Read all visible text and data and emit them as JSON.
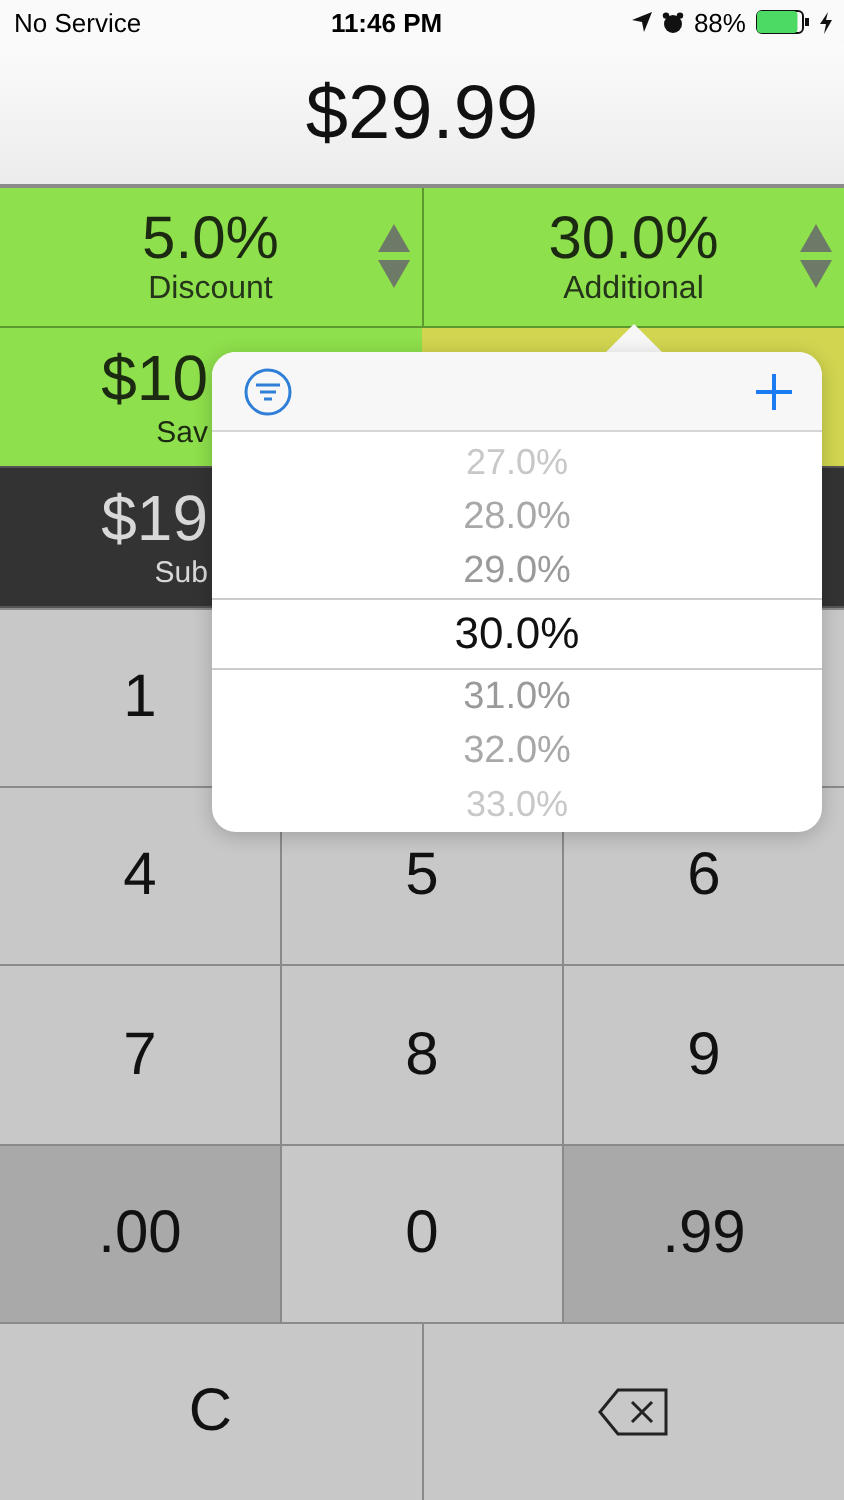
{
  "status_bar": {
    "carrier": "No Service",
    "time": "11:46 PM",
    "battery_percent": "88%",
    "battery": {
      "level": 0.88,
      "charging": true
    }
  },
  "price": "$29.99",
  "rates": [
    {
      "value": "5.0%",
      "label": "Discount"
    },
    {
      "value": "30.0%",
      "label": "Additional"
    }
  ],
  "results": [
    {
      "kind": "savings",
      "value": "$10",
      "label": "Sav"
    },
    {
      "kind": "subtotal",
      "value": "$19",
      "label": "Sub"
    }
  ],
  "keypad": [
    [
      {
        "label": "1",
        "kind": "digit"
      }
    ],
    [
      {
        "label": "4",
        "kind": "digit"
      },
      {
        "label": "5",
        "kind": "digit"
      },
      {
        "label": "6",
        "kind": "digit"
      }
    ],
    [
      {
        "label": "7",
        "kind": "digit"
      },
      {
        "label": "8",
        "kind": "digit"
      },
      {
        "label": "9",
        "kind": "digit"
      }
    ],
    [
      {
        "label": ".00",
        "kind": "special"
      },
      {
        "label": "0",
        "kind": "digit"
      },
      {
        "label": ".99",
        "kind": "special"
      }
    ],
    [
      {
        "label": "C",
        "kind": "clear"
      },
      {
        "kind": "backspace"
      }
    ]
  ],
  "picker": {
    "options": [
      {
        "label": "27.0%",
        "selected": false
      },
      {
        "label": "28.0%",
        "selected": false
      },
      {
        "label": "29.0%",
        "selected": false
      },
      {
        "label": "30.0%",
        "selected": true
      },
      {
        "label": "31.0%",
        "selected": false
      },
      {
        "label": "32.0%",
        "selected": false
      },
      {
        "label": "33.0%",
        "selected": false
      }
    ]
  }
}
